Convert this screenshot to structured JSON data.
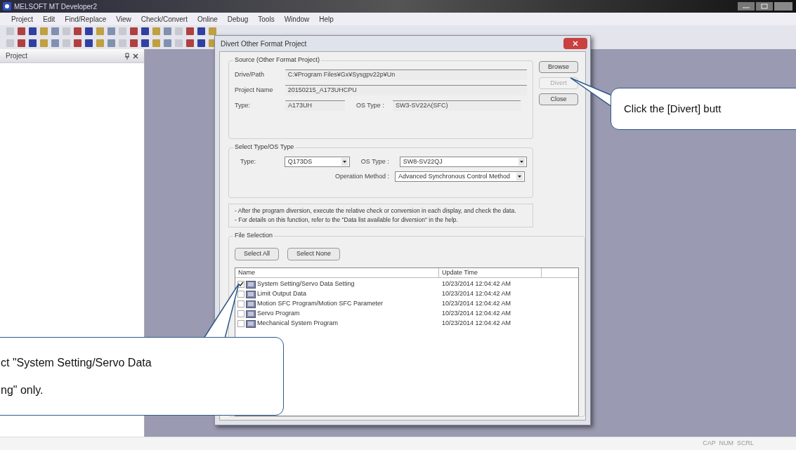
{
  "window": {
    "title": "MELSOFT MT Developer2"
  },
  "menu": [
    "Project",
    "Edit",
    "Find/Replace",
    "View",
    "Check/Convert",
    "Online",
    "Debug",
    "Tools",
    "Window",
    "Help"
  ],
  "project_panel": {
    "title": "Project"
  },
  "dialog": {
    "title": "Divert Other Format Project",
    "source": {
      "title": "Source (Other Format Project)",
      "fields": [
        {
          "label": "Drive/Path",
          "value": "C:¥Program Files¥Gx¥Sysgpv22p¥Un"
        },
        {
          "label": "Project Name",
          "value": "20150215_A173UHCPU"
        }
      ],
      "type_label": "Type:",
      "type_value": "A173UH",
      "os_label": "OS Type :",
      "os_value": "SW3-SV22A(SFC)"
    },
    "buttons": [
      {
        "label": "Browse",
        "disabled": false
      },
      {
        "label": "Divert",
        "disabled": true
      },
      {
        "label": "Close",
        "disabled": false
      }
    ],
    "select": {
      "title": "Select Type/OS Type",
      "type_label": "Type:",
      "type_value": "Q173DS",
      "os_label": "OS Type :",
      "os_value": "SW8-SV22QJ",
      "method_label": "Operation Method :",
      "method_value": "Advanced Synchronous Control Method"
    },
    "note": [
      "- After the program diversion, execute the relative check or conversion in each display, and check the data.",
      "- For details on this function, refer to the \"Data list available for diversion\" in the help."
    ],
    "file_selection": {
      "title": "File Selection",
      "buttons": [
        "Select All",
        "Select None"
      ],
      "columns": [
        "Name",
        "Update Time"
      ],
      "rows": [
        {
          "name": "System Setting/Servo Data Setting",
          "time": "10/23/2014 12:04:42 AM",
          "checked": true
        },
        {
          "name": "Limit Output Data",
          "time": "10/23/2014 12:04:42 AM",
          "checked": false
        },
        {
          "name": "Motion SFC Program/Motion SFC Parameter",
          "time": "10/23/2014 12:04:42 AM",
          "checked": false
        },
        {
          "name": "Servo Program",
          "time": "10/23/2014 12:04:42 AM",
          "checked": false
        },
        {
          "name": "Mechanical System Program",
          "time": "10/23/2014 12:04:42 AM",
          "checked": false
        }
      ]
    }
  },
  "callouts": [
    {
      "text": "Click the [Divert] butt"
    },
    {
      "text": "ct \"System Setting/Servo Data\nng\" only."
    }
  ],
  "status_bar": "CAP  NUM  SCRL"
}
